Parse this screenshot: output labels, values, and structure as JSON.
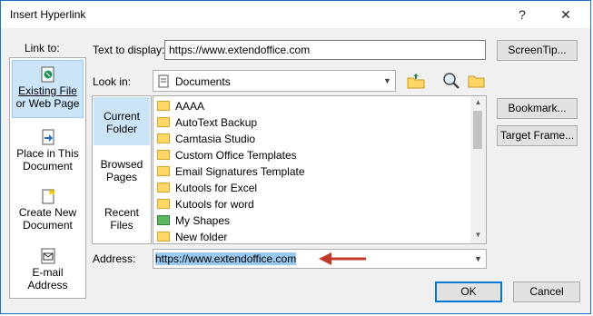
{
  "window": {
    "title": "Insert Hyperlink",
    "help_glyph": "?",
    "close_glyph": "✕"
  },
  "link_to": {
    "label": "Link to:",
    "items": [
      {
        "label_line1": "Existing File",
        "label_line2": "or Web Page",
        "icon": "web-page-icon"
      },
      {
        "label_line1": "Place in This",
        "label_line2": "Document",
        "icon": "document-place-icon"
      },
      {
        "label_line1": "Create New",
        "label_line2": "Document",
        "icon": "new-document-icon"
      },
      {
        "label_line1": "E-mail",
        "label_line2": "Address",
        "icon": "email-icon"
      }
    ]
  },
  "text_to_display": {
    "label": "Text to display:",
    "value": "https://www.extendoffice.com"
  },
  "screentip_button": "ScreenTip...",
  "look_in": {
    "label": "Look in:",
    "value": "Documents"
  },
  "sub_nav": [
    {
      "line1": "Current",
      "line2": "Folder"
    },
    {
      "line1": "Browsed",
      "line2": "Pages"
    },
    {
      "line1": "Recent",
      "line2": "Files"
    }
  ],
  "files": [
    "AAAA",
    "AutoText Backup",
    "Camtasia Studio",
    "Custom Office Templates",
    "Email Signatures Template",
    "Kutools for Excel",
    "Kutools for word",
    "My Shapes",
    "New folder"
  ],
  "bookmark_button": "Bookmark...",
  "target_frame_button": "Target Frame...",
  "address": {
    "label": "Address:",
    "value": "https://www.extendoffice.com"
  },
  "ok_button": "OK",
  "cancel_button": "Cancel",
  "colors": {
    "accent": "#0078d7",
    "arrow": "#c0392b",
    "selection": "#cce4f7"
  }
}
